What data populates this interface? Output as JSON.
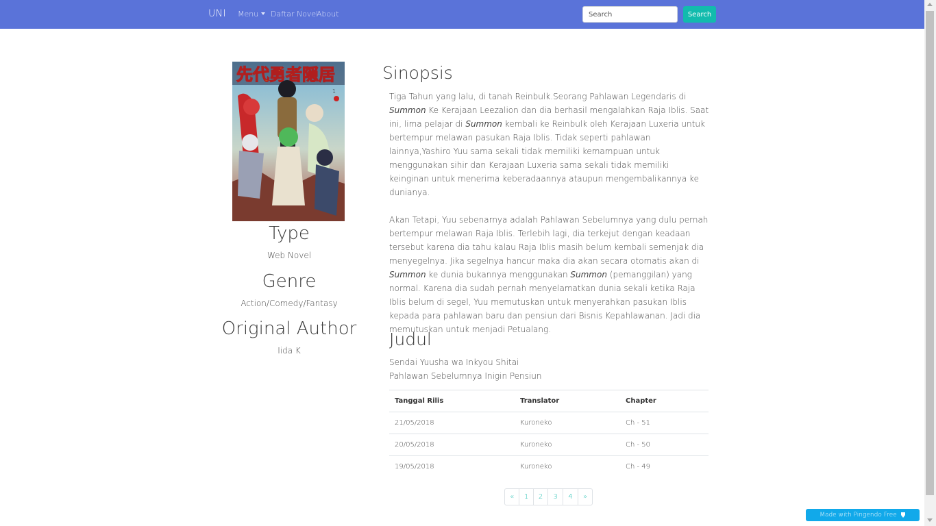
{
  "navbar": {
    "brand": "UNI",
    "menu_label": "Menu",
    "links": [
      "Daftar Novel",
      "About"
    ],
    "search_placeholder": "Search",
    "search_button": "Search",
    "bg_color": "#5a73d9"
  },
  "info": {
    "cover_alt": "novel-cover",
    "type_heading": "Type",
    "type_value": "Web Novel",
    "genre_heading": "Genre",
    "genre_value": "Action/Comedy/Fantasy",
    "author_heading": "Original Author",
    "author_value": "Iida K"
  },
  "synopsis": {
    "title": "Sinopsis",
    "p1": {
      "a": "Tiga Tahun yang lalu, di tanah Reinbulk.Seorang Pahlawan Legendaris di ",
      "em1": "Summon",
      "b": " Ke Kerajaan Leezalion dan dia berhasil mengalahkan Raja Iblis. Saat ini, lima pelajar di ",
      "em2": "Summon",
      "c": " kembali ke Reinbulk oleh Kerajaan Luxeria untuk bertempur melawan pasukan Raja Iblis. Tidak seperti pahlawan lainnya,Yashiro Yuu sama sekali tidak memiliki kemampuan untuk menggunakan sihir dan Kerajaan Luxeria sama sekali tidak memiliki keinginan untuk menerima keberadaannya ataupun mengembalikannya ke dunianya."
    },
    "p2": {
      "a": "Akan Tetapi, Yuu sebenarnya adalah Pahlawan Sebelumnya yang dulu pernah bertempur melawan Raja Iblis. Terlebih lagi, dia terkejut dengan keadaan tersebut karena dia tahu kalau Raja Iblis masih belum kembali semenjak dia menyegelnya. Jika segelnya hancur maka dia akan secara otomatis akan di ",
      "em1": "Summon",
      "b": " ke dunia bukannya menggunakan ",
      "em2": "Summon",
      "c": " (pemanggilan) yang normal. Karena dia sudah pernah menyelamatkan dunia sekali ketika Raja Iblis belum di segel, Yuu memutuskan untuk menyerahkan pasukan Iblis kepada para pahlawan baru dan pensiun dari Bisnis Kepahlawanan. Jadi dia memutuskan untuk menjadi Petualang."
    }
  },
  "judul": {
    "title": "Judul",
    "line1": "Sendai Yuusha wa Inkyou Shitai",
    "line2": "Pahlawan Sebelumnya Inigin Pensiun"
  },
  "table": {
    "headers": [
      "Tanggal Rilis",
      "Translator",
      "Chapter"
    ],
    "rows": [
      [
        "21/05/2018",
        "Kuroneko",
        "Ch - 51"
      ],
      [
        "20/05/2018",
        "Kuroneko",
        "Ch - 50"
      ],
      [
        "19/05/2018",
        "Kuroneko",
        "Ch - 49"
      ]
    ]
  },
  "pagination": {
    "prev": "«",
    "pages": [
      "1",
      "2",
      "3",
      "4"
    ],
    "next": "»",
    "accent": "#12bbad"
  },
  "pingendo_badge": "Made with Pingendo Free"
}
